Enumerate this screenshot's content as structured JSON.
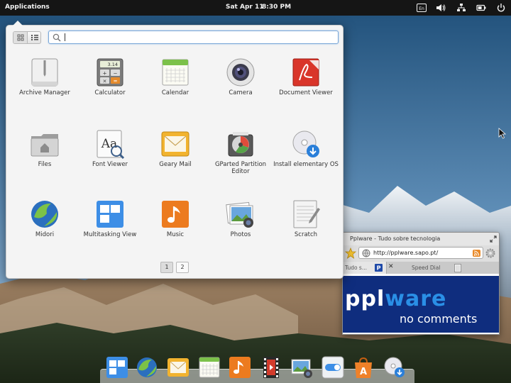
{
  "top_panel": {
    "applications_label": "Applications",
    "date": "Sat Apr 11",
    "time": "8:30 PM",
    "indicators": [
      "keyboard-layout-icon",
      "volume-icon",
      "network-icon",
      "battery-icon",
      "power-icon"
    ],
    "keyboard_layout": "En"
  },
  "app_menu": {
    "view_modes": [
      "grid-view-icon",
      "category-view-icon"
    ],
    "search": {
      "value": "",
      "placeholder": ""
    },
    "apps": [
      {
        "name": "Archive Manager",
        "icon": "archive-manager-icon"
      },
      {
        "name": "Calculator",
        "icon": "calculator-icon",
        "display": "3.14"
      },
      {
        "name": "Calendar",
        "icon": "calendar-icon"
      },
      {
        "name": "Camera",
        "icon": "camera-icon"
      },
      {
        "name": "Document Viewer",
        "icon": "document-viewer-icon"
      },
      {
        "name": "Files",
        "icon": "files-icon"
      },
      {
        "name": "Font Viewer",
        "icon": "font-viewer-icon",
        "glyph": "Aa"
      },
      {
        "name": "Geary Mail",
        "icon": "geary-mail-icon"
      },
      {
        "name": "GParted Partition Editor",
        "icon": "gparted-icon"
      },
      {
        "name": "Install elementary OS",
        "icon": "install-os-icon"
      },
      {
        "name": "Midori",
        "icon": "midori-icon"
      },
      {
        "name": "Multitasking View",
        "icon": "multitasking-view-icon"
      },
      {
        "name": "Music",
        "icon": "music-icon"
      },
      {
        "name": "Photos",
        "icon": "photos-icon"
      },
      {
        "name": "Scratch",
        "icon": "scratch-icon"
      }
    ],
    "pages": [
      "1",
      "2"
    ],
    "current_page": "1"
  },
  "browser": {
    "title": "Pplware - Tudo sobre tecnologia",
    "url": "http://pplware.sapo.pt/",
    "tabs": [
      "Tudo s...",
      "Speed Dial"
    ],
    "banner": {
      "logo": "pplware",
      "logo_hi": "ware",
      "logo_lo": "ppl",
      "tagline": "no comments"
    }
  },
  "dock": {
    "items": [
      "multitasking-view-icon",
      "midori-icon",
      "geary-mail-icon",
      "calendar-icon",
      "music-icon",
      "videos-icon",
      "photos-icon",
      "switchboard-icon",
      "app-center-icon",
      "install-os-icon"
    ]
  },
  "colors": {
    "panel": "#151515",
    "menu_bg": "#f4f4f4",
    "accent": "#3689e6",
    "banner_bg": "#0f2d7e"
  }
}
